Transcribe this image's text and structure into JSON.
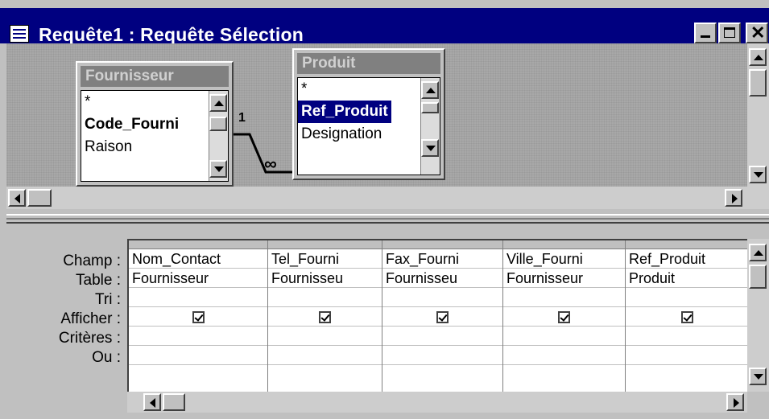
{
  "window": {
    "title": "Requête1 : Requête Sélection",
    "icons": {
      "app": "query-icon",
      "minimize": "minimize-icon",
      "maximize": "maximize-icon",
      "close": "close-icon"
    }
  },
  "tables": [
    {
      "name": "Fournisseur",
      "fields": [
        "*",
        "Code_Fourni",
        "Raison"
      ]
    },
    {
      "name": "Produit",
      "fields": [
        "*",
        "Ref_Produit",
        "Designation"
      ],
      "selected": "Ref_Produit"
    }
  ],
  "join": {
    "from_label": "1",
    "to_label": "∞"
  },
  "grid": {
    "row_labels": [
      "Champ :",
      "Table :",
      "Tri :",
      "Afficher :",
      "Critères :",
      "Ou :"
    ],
    "columns": [
      {
        "field": "Nom_Contact",
        "table": "Fournisseur",
        "sort": "",
        "show": true,
        "criteria": "",
        "or": ""
      },
      {
        "field": "Tel_Fourni",
        "table": "Fournisseu",
        "sort": "",
        "show": true,
        "criteria": "",
        "or": ""
      },
      {
        "field": "Fax_Fourni",
        "table": "Fournisseu",
        "sort": "",
        "show": true,
        "criteria": "",
        "or": ""
      },
      {
        "field": "Ville_Fourni",
        "table": "Fournisseur",
        "sort": "",
        "show": true,
        "criteria": "",
        "or": ""
      },
      {
        "field": "Ref_Produit",
        "table": "Produit",
        "sort": "",
        "show": true,
        "criteria": "",
        "or": ""
      }
    ]
  },
  "colors": {
    "titlebar": "#000080",
    "face": "#c0c0c0",
    "selection": "#000080"
  }
}
